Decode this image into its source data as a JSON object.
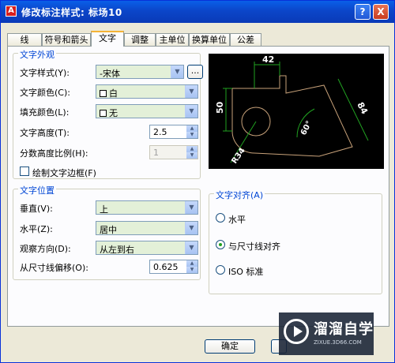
{
  "window": {
    "title": "修改标注样式: 标场10",
    "help_label": "?",
    "close_label": "X",
    "app_icon_label": "A"
  },
  "tabs": [
    {
      "label": "线"
    },
    {
      "label": "符号和箭头"
    },
    {
      "label": "文字"
    },
    {
      "label": "调整"
    },
    {
      "label": "主单位"
    },
    {
      "label": "换算单位"
    },
    {
      "label": "公差"
    }
  ],
  "active_tab": "文字",
  "text_appearance": {
    "title": "文字外观",
    "style_label": "文字样式(Y):",
    "style_value": "-宋体",
    "browse_label": "...",
    "color_label": "文字颜色(C):",
    "color_value": "白",
    "fill_label": "填充颜色(L):",
    "fill_value": "无",
    "height_label": "文字高度(T):",
    "height_value": "2.5",
    "fraction_label": "分数高度比例(H):",
    "fraction_value": "1",
    "frame_label": "绘制文字边框(F)"
  },
  "text_placement": {
    "title": "文字位置",
    "vertical_label": "垂直(V):",
    "vertical_value": "上",
    "horizontal_label": "水平(Z):",
    "horizontal_value": "居中",
    "view_dir_label": "观察方向(D):",
    "view_dir_value": "从左到右",
    "offset_label": "从尺寸线偏移(O):",
    "offset_value": "0.625"
  },
  "text_alignment": {
    "title": "文字对齐(A)",
    "options": [
      {
        "label": "水平",
        "checked": false
      },
      {
        "label": "与尺寸线对齐",
        "checked": true
      },
      {
        "label": "ISO 标准",
        "checked": false
      }
    ]
  },
  "preview": {
    "dim_top": "42",
    "dim_left": "50",
    "dim_right": "84",
    "dim_angle": "60°",
    "dim_radius": "R34"
  },
  "buttons": {
    "ok_label": "确定"
  },
  "watermark": {
    "brand": "溜溜自学",
    "url": "ZIXUE.3D66.COM"
  },
  "colors": {
    "title_bar": "#0b46c9",
    "combo_bg": "#e3f0d8",
    "group_title": "#0046d5",
    "preview_bg": "#000000",
    "dim_color": "#21a121",
    "outline_color": "#c8a27a"
  }
}
